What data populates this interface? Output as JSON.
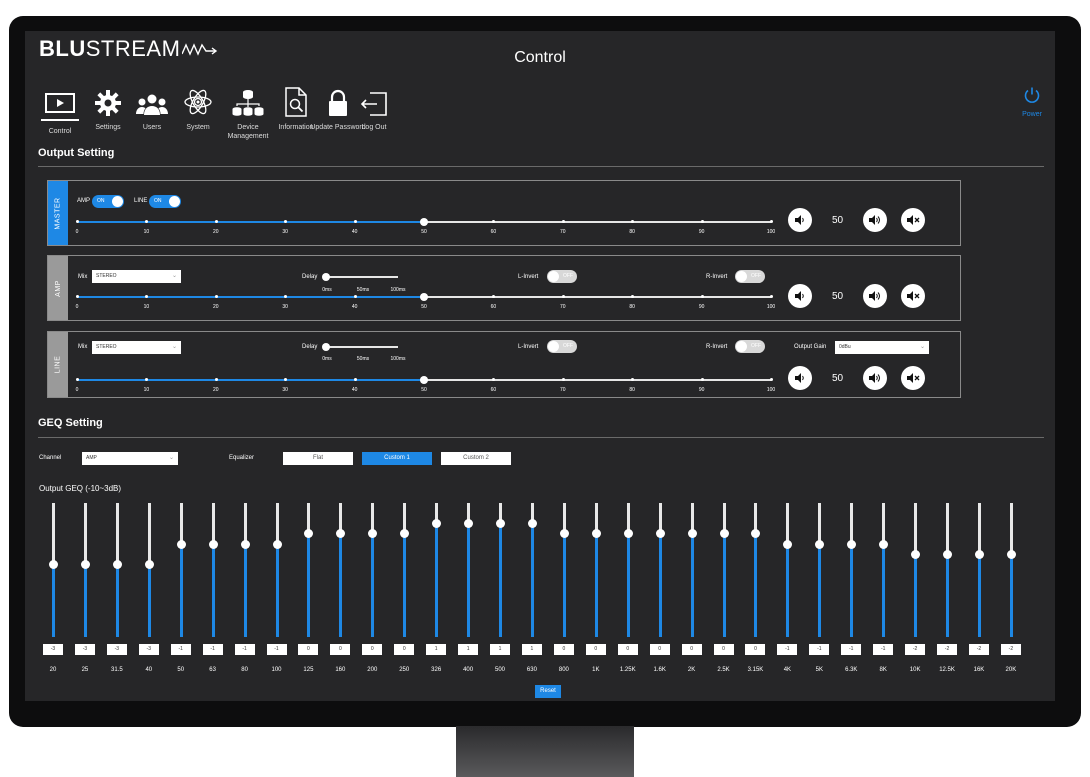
{
  "brand": {
    "logo_bold": "BLU",
    "logo_light": "STREAM",
    "accent": "#1e88e5"
  },
  "header": {
    "title": "Control"
  },
  "nav": [
    {
      "label": "Control",
      "icon": "monitor-play-icon"
    },
    {
      "label": "Settings",
      "icon": "gear-icon"
    },
    {
      "label": "Users",
      "icon": "users-icon"
    },
    {
      "label": "System",
      "icon": "atom-icon"
    },
    {
      "label": "Device Management",
      "icon": "network-icon"
    },
    {
      "label": "Information",
      "icon": "document-search-icon"
    },
    {
      "label": "Update Password",
      "icon": "lock-icon"
    },
    {
      "label": "Log Out",
      "icon": "logout-icon"
    }
  ],
  "power": {
    "label": "Power"
  },
  "output_setting": {
    "title": "Output Setting",
    "master": {
      "tab": "MASTER",
      "amp_label": "AMP",
      "amp_state": "ON",
      "line_label": "LINE",
      "line_state": "ON",
      "slider_value": 50,
      "volume": "50"
    },
    "amp": {
      "tab": "AMP",
      "mix_label": "Mix",
      "mix_value": "STEREO",
      "delay_label": "Delay",
      "delay_ticks": [
        "0ms",
        "50ms",
        "100ms"
      ],
      "l_invert_label": "L-Invert",
      "l_invert_state": "OFF",
      "r_invert_label": "R-Invert",
      "r_invert_state": "OFF",
      "slider_value": 50,
      "volume": "50"
    },
    "line": {
      "tab": "LINE",
      "mix_label": "Mix",
      "mix_value": "STEREO",
      "delay_label": "Delay",
      "delay_ticks": [
        "0ms",
        "50ms",
        "100ms"
      ],
      "l_invert_label": "L-Invert",
      "l_invert_state": "OFF",
      "r_invert_label": "R-Invert",
      "r_invert_state": "OFF",
      "output_gain_label": "Output Gain",
      "output_gain_value": "0dBu",
      "slider_value": 50,
      "volume": "50"
    },
    "scale_ticks": [
      "0",
      "10",
      "20",
      "30",
      "40",
      "50",
      "60",
      "70",
      "80",
      "90",
      "100"
    ]
  },
  "geq": {
    "title": "GEQ Setting",
    "channel_label": "Channel",
    "channel_value": "AMP",
    "equalizer_label": "Equalizer",
    "presets": [
      "Flat",
      "Custom 1",
      "Custom 2"
    ],
    "selected_preset": "Custom 1",
    "output_label": "Output GEQ  (-10~3dB)",
    "bands": [
      {
        "freq": "20",
        "value": -3
      },
      {
        "freq": "25",
        "value": -3
      },
      {
        "freq": "31.5",
        "value": -3
      },
      {
        "freq": "40",
        "value": -3
      },
      {
        "freq": "50",
        "value": -1
      },
      {
        "freq": "63",
        "value": -1
      },
      {
        "freq": "80",
        "value": -1
      },
      {
        "freq": "100",
        "value": -1
      },
      {
        "freq": "125",
        "value": 0
      },
      {
        "freq": "160",
        "value": 0
      },
      {
        "freq": "200",
        "value": 0
      },
      {
        "freq": "250",
        "value": 0
      },
      {
        "freq": "326",
        "value": 1
      },
      {
        "freq": "400",
        "value": 1
      },
      {
        "freq": "500",
        "value": 1
      },
      {
        "freq": "630",
        "value": 1
      },
      {
        "freq": "800",
        "value": 0
      },
      {
        "freq": "1K",
        "value": 0
      },
      {
        "freq": "1.25K",
        "value": 0
      },
      {
        "freq": "1.6K",
        "value": 0
      },
      {
        "freq": "2K",
        "value": 0
      },
      {
        "freq": "2.5K",
        "value": 0
      },
      {
        "freq": "3.15K",
        "value": 0
      },
      {
        "freq": "4K",
        "value": -1
      },
      {
        "freq": "5K",
        "value": -1
      },
      {
        "freq": "6.3K",
        "value": -1
      },
      {
        "freq": "8K",
        "value": -1
      },
      {
        "freq": "10K",
        "value": -2
      },
      {
        "freq": "12.5K",
        "value": -2
      },
      {
        "freq": "16K",
        "value": -2
      },
      {
        "freq": "20K",
        "value": -2
      }
    ],
    "range": [
      -10,
      3
    ],
    "reset_label": "Reset"
  }
}
